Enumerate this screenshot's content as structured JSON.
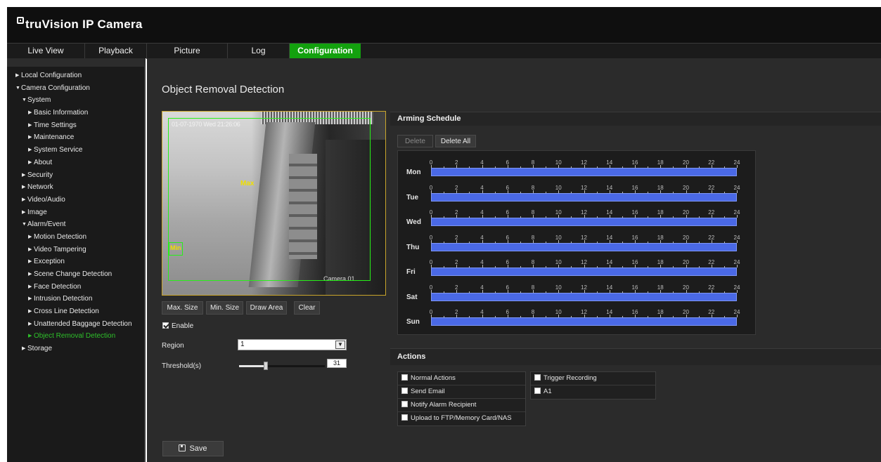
{
  "app": {
    "title": "truVision IP Camera"
  },
  "nav": {
    "tabs": [
      "Live View",
      "Playback",
      "Picture",
      "Log",
      "Configuration"
    ],
    "active": "Configuration",
    "accent": "#13a10e"
  },
  "sidebar": {
    "items": [
      {
        "label": "Local Configuration",
        "level": 0,
        "open": false
      },
      {
        "label": "Camera Configuration",
        "level": 0,
        "open": true
      },
      {
        "label": "System",
        "level": 1,
        "open": true
      },
      {
        "label": "Basic Information",
        "level": 2,
        "open": false
      },
      {
        "label": "Time Settings",
        "level": 2,
        "open": false
      },
      {
        "label": "Maintenance",
        "level": 2,
        "open": false
      },
      {
        "label": "System Service",
        "level": 2,
        "open": false
      },
      {
        "label": "About",
        "level": 2,
        "open": false
      },
      {
        "label": "Security",
        "level": 1,
        "open": false
      },
      {
        "label": "Network",
        "level": 1,
        "open": false
      },
      {
        "label": "Video/Audio",
        "level": 1,
        "open": false
      },
      {
        "label": "Image",
        "level": 1,
        "open": false
      },
      {
        "label": "Alarm/Event",
        "level": 1,
        "open": true
      },
      {
        "label": "Motion Detection",
        "level": 2,
        "open": false
      },
      {
        "label": "Video Tampering",
        "level": 2,
        "open": false
      },
      {
        "label": "Exception",
        "level": 2,
        "open": false
      },
      {
        "label": "Scene Change Detection",
        "level": 2,
        "open": false
      },
      {
        "label": "Face Detection",
        "level": 2,
        "open": false
      },
      {
        "label": "Intrusion Detection",
        "level": 2,
        "open": false
      },
      {
        "label": "Cross Line Detection",
        "level": 2,
        "open": false
      },
      {
        "label": "Unattended Baggage Detection",
        "level": 2,
        "open": false
      },
      {
        "label": "Object Removal Detection",
        "level": 2,
        "open": false,
        "active": true
      },
      {
        "label": "Storage",
        "level": 1,
        "open": false
      }
    ]
  },
  "main": {
    "title": "Object Removal Detection",
    "video": {
      "timestamp": "01-07-1970 Wed 21:26:06",
      "camera_name": "Camera 01",
      "max_label": "Max",
      "min_label": "Min"
    },
    "draw_buttons": [
      "Max. Size",
      "Min. Size",
      "Draw Area",
      "Clear"
    ],
    "enable": {
      "label": "Enable",
      "checked": true
    },
    "region": {
      "label": "Region",
      "value": "1"
    },
    "threshold": {
      "label": "Threshold(s)",
      "value": "31",
      "fraction": 0.31
    },
    "save_label": "Save"
  },
  "schedule": {
    "title": "Arming Schedule",
    "delete_label": "Delete",
    "delete_all_label": "Delete All",
    "days": [
      "Mon",
      "Tue",
      "Wed",
      "Thu",
      "Fri",
      "Sat",
      "Sun"
    ],
    "hour_labels": [
      "0",
      "2",
      "4",
      "6",
      "8",
      "10",
      "12",
      "14",
      "16",
      "18",
      "20",
      "22",
      "24"
    ],
    "bar_color": "#4a69e6"
  },
  "actions": {
    "title": "Actions",
    "left": [
      {
        "label": "Normal Actions",
        "checked": false
      },
      {
        "label": "Send Email",
        "checked": false
      },
      {
        "label": "Notify Alarm Recipient",
        "checked": false
      },
      {
        "label": "Upload to FTP/Memory Card/NAS",
        "checked": false
      }
    ],
    "right": [
      {
        "label": "Trigger Recording",
        "checked": false
      },
      {
        "label": "A1",
        "checked": false
      }
    ]
  }
}
